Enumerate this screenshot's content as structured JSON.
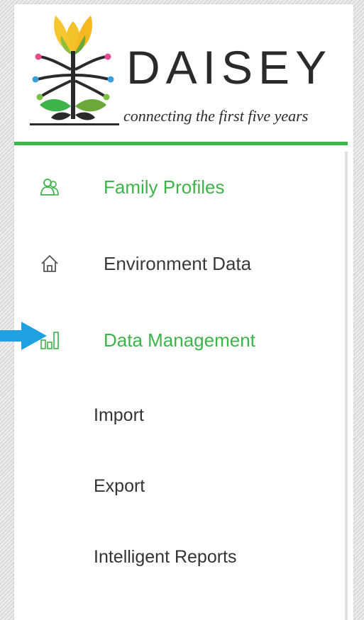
{
  "colors": {
    "green": "#3db34a",
    "text": "#3a3a3a",
    "arrow": "#1da1e2",
    "divider": "#3db34a"
  },
  "logo": {
    "brand": "DAISEY",
    "tagline": "connecting the first five years"
  },
  "nav": {
    "items": [
      {
        "label": "Family Profiles",
        "icon": "people-icon",
        "active": true
      },
      {
        "label": "Environment Data",
        "icon": "home-icon",
        "active": false
      },
      {
        "label": "Data Management",
        "icon": "bar-chart-icon",
        "active": true
      }
    ],
    "sub_items": [
      {
        "label": "Import"
      },
      {
        "label": "Export"
      },
      {
        "label": "Intelligent Reports"
      }
    ]
  }
}
